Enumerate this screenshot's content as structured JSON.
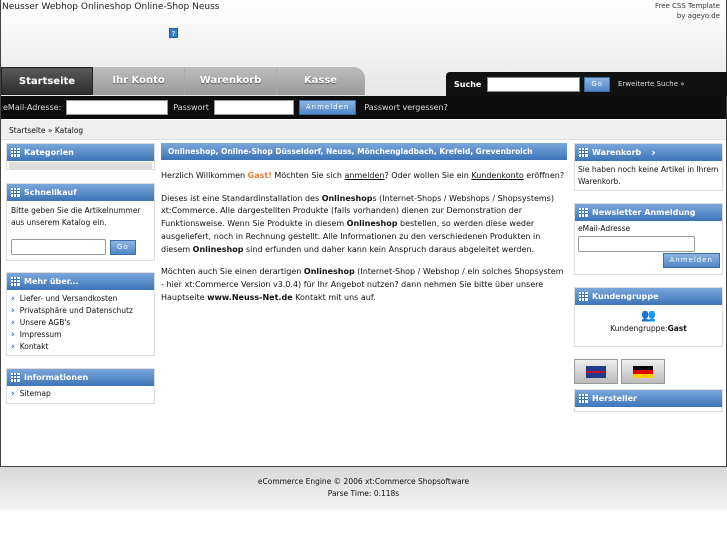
{
  "header": {
    "site_title": "Neusser Webhop Onlineshop Online-Shop Neuss",
    "credit_line1": "Free CSS Template",
    "credit_line2": "by ageyo.de",
    "help_icon": "?"
  },
  "tabs": [
    {
      "label": "Startseite"
    },
    {
      "label": "Ihr Konto"
    },
    {
      "label": "Warenkorb"
    },
    {
      "label": "Kasse"
    }
  ],
  "search": {
    "label": "Suche",
    "value": "",
    "go": "Go",
    "advanced": "Erweiterte Suche »"
  },
  "login": {
    "email_label": "eMail-Adresse:",
    "password_label": "Passwort",
    "submit": "Anmelden",
    "forgot": "Passwort vergessen?"
  },
  "breadcrumb": "Startseite » Katalog",
  "left": {
    "categories": {
      "title": "Kategorien"
    },
    "quickbuy": {
      "title": "Schnellkauf",
      "text": "Bitte geben Sie die Artikelnummer aus unserem Katalog ein.",
      "go": "Go"
    },
    "more": {
      "title": "Mehr über...",
      "items": [
        "Liefer- und Versandkosten",
        "Privatsphäre und Datenschutz",
        "Unsere AGB's",
        "Impressum",
        "Kontakt"
      ]
    },
    "info": {
      "title": "Informationen",
      "items": [
        "Sitemap"
      ]
    }
  },
  "center": {
    "title": "Onlineshop, Online-Shop Düsseldorf, Neuss, Mönchengladbach, Krefeld, Grevenbroich",
    "p1": {
      "a": "Herzlich Willkommen ",
      "gast": "Gast!",
      "b": " Möchten Sie sich ",
      "login": "anmelden",
      "c": "? Oder wollen Sie ein ",
      "account": "Kundenkonto",
      "d": " eröffnen?"
    },
    "p2": {
      "a": "Dieses ist eine Standardinstallation des ",
      "b1": "Onlineshop",
      "c": "s (Internet-Shops / Webshops / Shopsystems) xt:Commerce. Alle dargestellten Produkte (falls vorhanden) dienen zur Demonstration der Funktionsweise. Wenn Sie Produkte in diesem ",
      "b2": "Onlineshop",
      "d": " bestellen, so werden diese weder ausgeliefert, noch in Rechnung gestellt. Alle Informationen zu den verschiedenen Produkten in diesem ",
      "b3": "Onlineshop",
      "e": " sind erfunden und daher kann kein Anspruch daraus abgeleitet werden."
    },
    "p3": {
      "a": "Möchten auch Sie einen derartigen ",
      "b1": "Onlineshop",
      "c": " (Internet-Shop / Webshop / ein solches Shopsystem - hier xt:Commerce Version v3.0.4) für Ihr Angebot nutzen? dann nehmen Sie bitte über unsere Hauptseite ",
      "b2": "www.Neuss-Net.de",
      "d": " Kontakt mit uns auf."
    }
  },
  "right": {
    "cart": {
      "title": "Warenkorb",
      "text": "Sie haben noch keine Artikel in Ihrem Warenkorb."
    },
    "newsletter": {
      "title": "Newsletter Anmeldung",
      "email_label": "eMail-Adresse",
      "submit": "Anmelden"
    },
    "group": {
      "title": "Kundengruppe",
      "label": "Kundengruppe:",
      "value": "Gast"
    },
    "manufacturers": {
      "title": "Hersteller"
    }
  },
  "footer": {
    "line1": "eCommerce Engine © 2006 xt:Commerce Shopsoftware",
    "line2": "Parse Time: 0.118s"
  }
}
